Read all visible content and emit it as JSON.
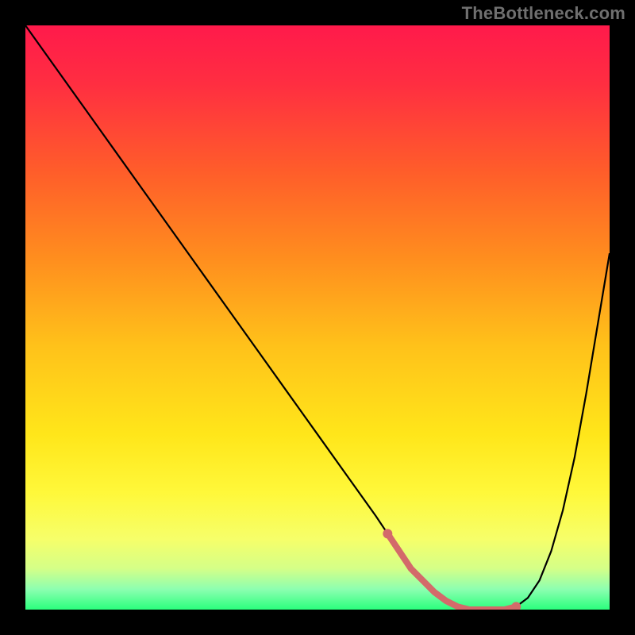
{
  "watermark": "TheBottleneck.com",
  "highlight_color": "#d36a6a",
  "chart_data": {
    "type": "line",
    "title": "",
    "xlabel": "",
    "ylabel": "",
    "xlim": [
      0,
      100
    ],
    "ylim": [
      0,
      100
    ],
    "x": [
      0,
      5,
      10,
      15,
      20,
      25,
      30,
      35,
      40,
      45,
      50,
      55,
      60,
      62,
      64,
      66,
      68,
      70,
      72,
      74,
      76,
      78,
      80,
      82,
      84,
      86,
      88,
      90,
      92,
      94,
      96,
      98,
      100
    ],
    "values": [
      100,
      93,
      86,
      79,
      72,
      65,
      58,
      51,
      44,
      37,
      30,
      23,
      16,
      13,
      10,
      7,
      5,
      3,
      1.5,
      0.5,
      0,
      0,
      0,
      0,
      0.5,
      2,
      5,
      10,
      17,
      26,
      37,
      49,
      61
    ],
    "highlight": {
      "x_start": 62,
      "x_end": 84
    },
    "gradient_stops": [
      {
        "offset": 0.0,
        "color": "#ff1a4b"
      },
      {
        "offset": 0.1,
        "color": "#ff2e41"
      },
      {
        "offset": 0.25,
        "color": "#ff5d2a"
      },
      {
        "offset": 0.4,
        "color": "#ff8e1e"
      },
      {
        "offset": 0.55,
        "color": "#ffc21a"
      },
      {
        "offset": 0.7,
        "color": "#ffe61a"
      },
      {
        "offset": 0.8,
        "color": "#fff83a"
      },
      {
        "offset": 0.88,
        "color": "#f6ff6a"
      },
      {
        "offset": 0.93,
        "color": "#d4ff88"
      },
      {
        "offset": 0.965,
        "color": "#8dffb0"
      },
      {
        "offset": 1.0,
        "color": "#2aff7d"
      }
    ]
  }
}
